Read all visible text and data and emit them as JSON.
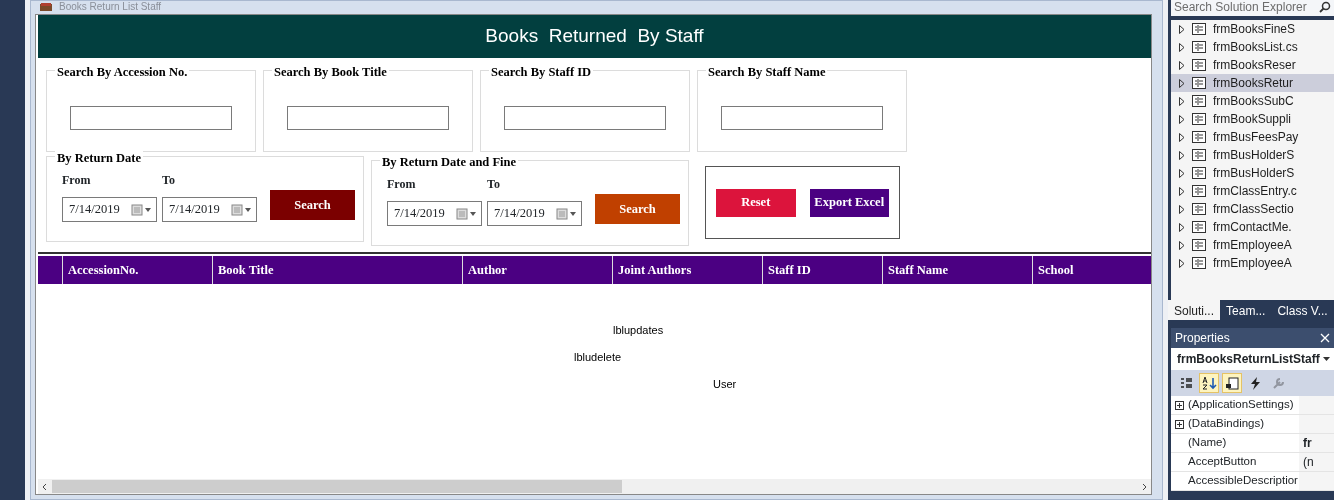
{
  "window": {
    "title": "Books Return List Staff"
  },
  "header": {
    "title": "Books  Returned  By Staff"
  },
  "search_groups": [
    {
      "label": "Search By Accession No."
    },
    {
      "label": "Search By Book Title"
    },
    {
      "label": "Search By Staff ID"
    },
    {
      "label": "Search By Staff Name"
    }
  ],
  "date_groups": [
    {
      "label": "By Return Date",
      "from_label": "From",
      "to_label": "To",
      "from": "7/14/2019",
      "to": "7/14/2019",
      "button": "Search",
      "color": "#7b0000"
    },
    {
      "label": "By Return Date and Fine",
      "from_label": "From",
      "to_label": "To",
      "from": "7/14/2019",
      "to": "7/14/2019",
      "button": "Search",
      "color": "#c04000"
    }
  ],
  "actions": [
    {
      "label": "Reset",
      "color": "#dc143c"
    },
    {
      "label": "Export Excel",
      "color": "#4b0082"
    }
  ],
  "grid": {
    "columns": [
      "AccessionNo.",
      "Book Title",
      "Author",
      "Joint Authors",
      "Staff ID",
      "Staff Name",
      "School"
    ]
  },
  "labels": [
    {
      "text": "lblupdates"
    },
    {
      "text": "lbludelete"
    },
    {
      "text": "User"
    }
  ],
  "solution_explorer": {
    "search_placeholder": "Search Solution Explorer",
    "items": [
      {
        "label": "frmBooksFineS",
        "selected": false
      },
      {
        "label": "frmBooksList.cs",
        "selected": false
      },
      {
        "label": "frmBooksReser",
        "selected": false
      },
      {
        "label": "frmBooksRetur",
        "selected": true
      },
      {
        "label": "frmBooksSubC",
        "selected": false
      },
      {
        "label": "frmBookSuppli",
        "selected": false
      },
      {
        "label": "frmBusFeesPay",
        "selected": false
      },
      {
        "label": "frmBusHolderS",
        "selected": false
      },
      {
        "label": "frmBusHolderS",
        "selected": false
      },
      {
        "label": "frmClassEntry.c",
        "selected": false
      },
      {
        "label": "frmClassSectio",
        "selected": false
      },
      {
        "label": "frmContactMe.",
        "selected": false
      },
      {
        "label": "frmEmployeeA",
        "selected": false
      },
      {
        "label": "frmEmployeeA",
        "selected": false
      }
    ],
    "tabs": [
      {
        "label": "Soluti...",
        "selected": true
      },
      {
        "label": "Team...",
        "selected": false
      },
      {
        "label": "Class V...",
        "selected": false
      }
    ]
  },
  "properties": {
    "title": "Properties",
    "object": "frmBooksReturnListStaff",
    "toolbar": [
      {
        "kind": "categorized",
        "selected": false,
        "disabled": false
      },
      {
        "kind": "alphabetical",
        "selected": true,
        "disabled": false
      },
      {
        "kind": "properties",
        "selected": true,
        "disabled": false
      },
      {
        "kind": "events",
        "selected": false,
        "disabled": false
      },
      {
        "kind": "pages",
        "selected": false,
        "disabled": true
      }
    ],
    "rows": [
      {
        "name": "(ApplicationSettings)",
        "expandable": true
      },
      {
        "name": "(DataBindings)",
        "expandable": true
      },
      {
        "name": "(Name)",
        "expandable": false,
        "value": "fr"
      },
      {
        "name": "AcceptButton",
        "expandable": false,
        "value": "(n"
      },
      {
        "name": "AccessibleDescriptior",
        "expandable": false
      }
    ]
  }
}
